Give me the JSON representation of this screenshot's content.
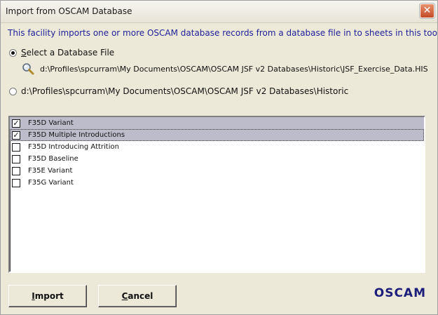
{
  "window": {
    "title": "Import from OSCAM Database",
    "close_glyph": "✕"
  },
  "description": "This facility imports one or more OSCAM database records from a database file in to sheets in this tool",
  "options": {
    "select_file": {
      "mnemonic": "S",
      "rest": "elect a Database File",
      "checked": true
    },
    "folder_path": {
      "label": "d:\\Profiles\\spcurram\\My Documents\\OSCAM\\OSCAM JSF v2 Databases\\Historic",
      "checked": false
    }
  },
  "file": {
    "icon": "magnifier-icon",
    "path": "d:\\Profiles\\spcurram\\My Documents\\OSCAM\\OSCAM JSF v2 Databases\\Historic\\JSF_Exercise_Data.HIS"
  },
  "records": [
    {
      "label": "F35D Variant",
      "checked": true
    },
    {
      "label": "F35D Multiple Introductions",
      "checked": true
    },
    {
      "label": "F35D Introducing Attrition",
      "checked": false
    },
    {
      "label": "F35D Baseline",
      "checked": false
    },
    {
      "label": "F35E Variant",
      "checked": false
    },
    {
      "label": "F35G Variant",
      "checked": false
    }
  ],
  "buttons": {
    "import": {
      "mnemonic": "I",
      "rest": "mport"
    },
    "cancel": {
      "mnemonic": "C",
      "rest": "ancel"
    }
  },
  "brand": "OSCAM",
  "colors": {
    "description_text": "#1f1f9a",
    "brand_text": "#1c1c7a",
    "selection": "#bcbccb",
    "close_button": "#c44a26"
  }
}
